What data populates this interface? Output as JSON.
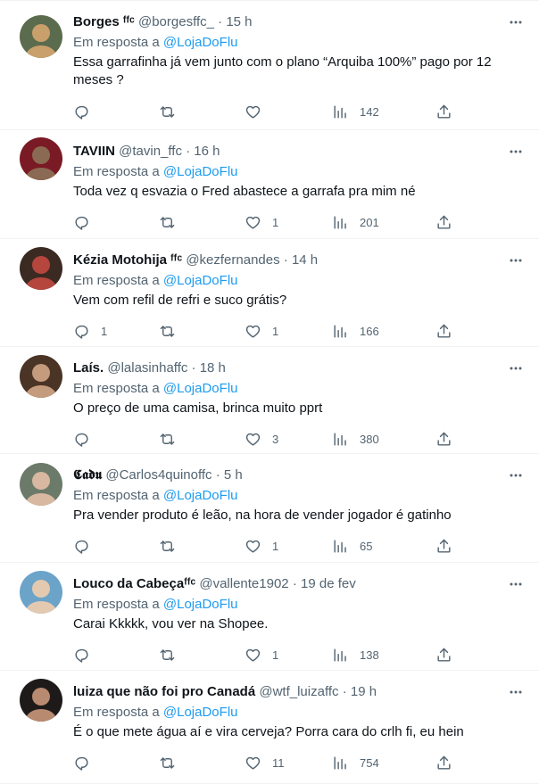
{
  "reply_prefix": "Em resposta a",
  "reply_target": "@LojaDoFlu",
  "tweets": [
    {
      "name": "Borges ᶠᶠᶜ",
      "handle": "@borgesffc_",
      "dot": "·",
      "time": "15 h",
      "text": "Essa garrafinha já vem junto com o plano “Arquiba 100%” pago por 12 meses ?",
      "replies": "",
      "retweets": "",
      "likes": "",
      "views": "142",
      "avatar_colors": [
        "#5b6b4e",
        "#c9a06b"
      ]
    },
    {
      "name": "TAVIIN",
      "handle": "@tavin_ffc",
      "dot": "·",
      "time": "16 h",
      "text": "Toda vez q esvazia o Fred abastece a garrafa pra mim né",
      "replies": "",
      "retweets": "",
      "likes": "1",
      "views": "201",
      "avatar_colors": [
        "#7a1a24",
        "#8a6a52"
      ]
    },
    {
      "name": "Kézia Motohija ᶠᶠᶜ",
      "handle": "@kezfernandes",
      "dot": "·",
      "time": "14 h",
      "text": "Vem com refil de refri e suco grátis?",
      "replies": "1",
      "retweets": "",
      "likes": "1",
      "views": "166",
      "avatar_colors": [
        "#3b2a22",
        "#b5463e"
      ]
    },
    {
      "name": "Laís.",
      "handle": "@lalasinhaffc",
      "dot": "·",
      "time": "18 h",
      "text": "O preço de uma camisa, brinca muito pprt",
      "replies": "",
      "retweets": "",
      "likes": "3",
      "views": "380",
      "avatar_colors": [
        "#4a3426",
        "#c49b7c"
      ]
    },
    {
      "name": "𝕮𝖆𝖉𝖚",
      "handle": "@Carlos4quinoffc",
      "dot": "·",
      "time": "5 h",
      "text": "Pra vender produto é leão, na hora de vender jogador é gatinho",
      "replies": "",
      "retweets": "",
      "likes": "1",
      "views": "65",
      "avatar_colors": [
        "#6c7a6a",
        "#d8b8a0"
      ]
    },
    {
      "name": "Louco da Cabeçaᶠᶠᶜ",
      "handle": "@vallente1902",
      "dot": "·",
      "time": "19 de fev",
      "text": "Carai Kkkkk, vou ver na Shopee.",
      "replies": "",
      "retweets": "",
      "likes": "1",
      "views": "138",
      "avatar_colors": [
        "#6ba3c9",
        "#e3c9b0"
      ]
    },
    {
      "name": "luiza que não foi pro Canadá",
      "handle": "@wtf_luizaffc",
      "dot": "·",
      "time": "19 h",
      "text": "É o que mete água aí e vira cerveja? Porra cara do crlh fi, eu hein",
      "replies": "",
      "retweets": "",
      "likes": "11",
      "views": "754",
      "avatar_colors": [
        "#1e1a1a",
        "#b88a70"
      ]
    }
  ],
  "icons": {
    "more": "more-dots-icon",
    "reply": "reply-bubble-icon",
    "retweet": "retweet-icon",
    "like": "heart-icon",
    "views": "views-bar-icon",
    "share": "share-icon"
  },
  "colors": {
    "link": "#1d9bf0",
    "muted": "#536471",
    "text": "#0f1419",
    "divider": "#eff3f4"
  }
}
